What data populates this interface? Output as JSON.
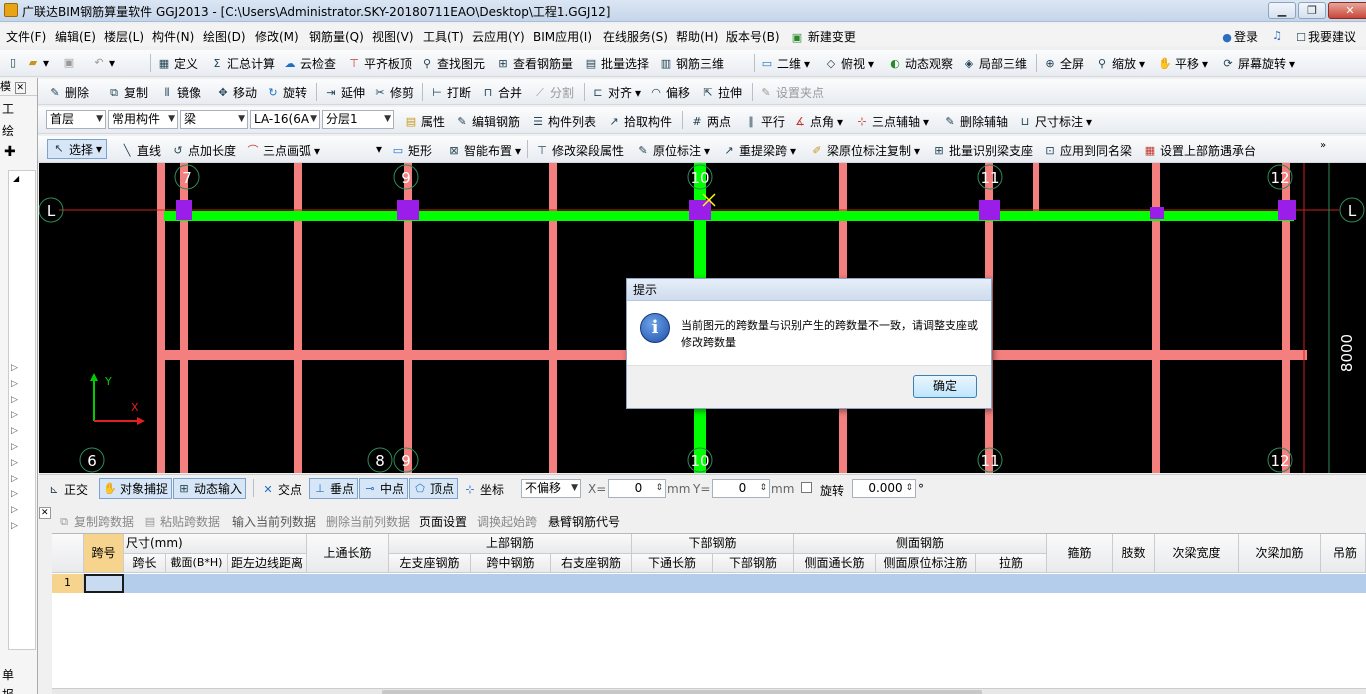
{
  "window": {
    "title": "广联达BIM钢筋算量软件 GGJ2013 - [C:\\Users\\Administrator.SKY-20180711EAO\\Desktop\\工程1.GGJ12]",
    "minimize": "▁",
    "restore": "❐",
    "close": "✕"
  },
  "menu": {
    "items": [
      "文件(F)",
      "编辑(E)",
      "楼层(L)",
      "构件(N)",
      "绘图(D)",
      "修改(M)",
      "钢筋量(Q)",
      "视图(V)",
      "工具(T)",
      "云应用(Y)",
      "BIM应用(I)",
      "在线服务(S)",
      "帮助(H)",
      "版本号(B)",
      "新建变更"
    ],
    "login": "登录",
    "suggest": "我要建议"
  },
  "toolbar1": {
    "define": "定义",
    "sum": "汇总计算",
    "cloud_check": "云检查",
    "flush_top": "平齐板顶",
    "find": "查找图元",
    "view_rebar": "查看钢筋量",
    "batch_select": "批量选择",
    "rebar_3d": "钢筋三维",
    "view_2d": "二维",
    "top_view": "俯视",
    "dynamic": "动态观察",
    "local_3d": "局部三维",
    "fullscreen": "全屏",
    "zoom": "缩放",
    "pan": "平移",
    "rotate": "屏幕旋转"
  },
  "toolbar2": {
    "delete": "删除",
    "copy": "复制",
    "mirror": "镜像",
    "move": "移动",
    "rotate": "旋转",
    "extend": "延伸",
    "trim": "修剪",
    "break": "打断",
    "merge": "合并",
    "split": "分割",
    "align": "对齐",
    "offset": "偏移",
    "stretch": "拉伸",
    "grip": "设置夹点"
  },
  "toolbar3": {
    "floor": "首层",
    "component_type": "常用构件",
    "component": "梁",
    "member": "LA-16(6A",
    "layer": "分层1",
    "props": "属性",
    "edit_rebar": "编辑钢筋",
    "component_list": "构件列表",
    "pick": "拾取构件",
    "two_points": "两点",
    "parallel": "平行",
    "point_angle": "点角",
    "three_point_axis": "三点辅轴",
    "delete_axis": "删除辅轴",
    "dimension": "尺寸标注"
  },
  "toolbar4": {
    "select": "选择",
    "line": "直线",
    "point_length": "点加长度",
    "arc": "三点画弧",
    "rect": "矩形",
    "smart_layout": "智能布置",
    "edit_span": "修改梁段属性",
    "original_mark": "原位标注",
    "re_extract": "重提梁跨",
    "copy_mark": "梁原位标注复制",
    "batch_identify": "批量识别梁支座",
    "apply_same": "应用到同名梁",
    "set_top": "设置上部筋遇承台"
  },
  "canvas": {
    "axis_top": [
      "7",
      "9",
      "10",
      "11",
      "12"
    ],
    "axis_bottom": [
      "6",
      "8",
      "9",
      "10",
      "11",
      "12"
    ],
    "axis_left": "L",
    "axis_right": "L",
    "dimension": "8000",
    "y_label": "Y",
    "x_label": "X"
  },
  "dialog": {
    "title": "提示",
    "message": "当前图元的跨数量与识别产生的跨数量不一致，请调整支座或修改跨数量",
    "ok": "确定",
    "icon": "info-icon"
  },
  "snapbar": {
    "ortho": "正交",
    "snap": "对象捕捉",
    "dyn_input": "动态输入",
    "intersection": "交点",
    "perpendicular": "垂点",
    "midpoint": "中点",
    "vertex": "顶点",
    "coord": "坐标",
    "offset_mode": "不偏移",
    "x_label": "X=",
    "x_value": "0",
    "y_label": "Y=",
    "y_value": "0",
    "mm": "mm",
    "rotate": "旋转",
    "rotate_value": "0.000",
    "degree": "°"
  },
  "rebarbar": {
    "copy_span": "复制跨数据",
    "paste_span": "粘贴跨数据",
    "input_col": "输入当前列数据",
    "delete_col": "删除当前列数据",
    "page_setup": "页面设置",
    "swap_start": "调换起始跨",
    "cantilever": "悬臂钢筋代号"
  },
  "table": {
    "headers": {
      "span_no": "跨号",
      "size": "尺寸(mm)",
      "span_len": "跨长",
      "section": "截面(B*H)",
      "edge_dist": "距左边线距离",
      "top_through": "上通长筋",
      "top_rebar": "上部钢筋",
      "left_support": "左支座钢筋",
      "mid_span": "跨中钢筋",
      "right_support": "右支座钢筋",
      "bottom_rebar": "下部钢筋",
      "bottom_through": "下通长筋",
      "bottom_sub": "下部钢筋",
      "side_rebar": "侧面钢筋",
      "side_through": "侧面通长筋",
      "side_original": "侧面原位标注筋",
      "tie": "拉筋",
      "stirrup": "箍筋",
      "legs": "肢数",
      "sec_width": "次梁宽度",
      "sec_add": "次梁加筋",
      "hanger": "吊筋"
    },
    "rows": [
      {
        "no": "1"
      }
    ]
  },
  "left_panel": {
    "tab1": "模",
    "tab2": "工",
    "tab3": "绘",
    "bottom1": "单",
    "bottom2": "报"
  }
}
